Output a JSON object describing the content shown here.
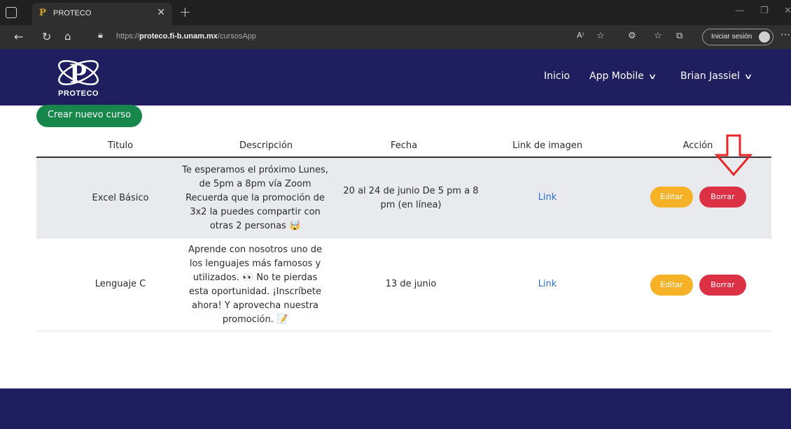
{
  "browser": {
    "tab_title": "PROTECO",
    "tab_favicon": "P",
    "url_prefix": "https://",
    "url_domain": "proteco.fi-b.unam.mx",
    "url_path": "/cursosApp",
    "signin_label": "Iniciar sesión"
  },
  "site": {
    "logo_text": "PROTECO",
    "nav": {
      "inicio": "Inicio",
      "app_mobile": "App Mobile",
      "user": "Brian Jassiel"
    }
  },
  "content": {
    "create_button": "Crear nuevo curso",
    "columns": [
      "Titulo",
      "Descripción",
      "Fecha",
      "Link de imagen",
      "Acción"
    ],
    "rows": [
      {
        "titulo": "Excel Básico",
        "descripcion": [
          "Te esperamos el próximo Lunes,",
          "de 5pm a 8pm vía Zoom",
          "Recuerda que la promoción de",
          "3x2 la puedes compartir con",
          "otras 2 personas 🤯"
        ],
        "fecha": [
          "20 al 24 de junio De 5 pm a 8",
          "pm (en línea)"
        ],
        "link": "Link",
        "edit": "Editar",
        "delete": "Borrar"
      },
      {
        "titulo": "Lenguaje C",
        "descripcion": [
          "Aprende con nosotros uno de",
          "los lenguajes más famosos y",
          "utilizados. 👀 No te pierdas",
          "esta oportunidad. ¡Inscríbete",
          "ahora! Y aprovecha nuestra",
          "promoción. 📝"
        ],
        "fecha": [
          "13 de junio"
        ],
        "link": "Link",
        "edit": "Editar",
        "delete": "Borrar"
      }
    ]
  },
  "colors": {
    "navbar": "#1f1f5f",
    "create": "#18874b",
    "edit": "#f5b227",
    "delete": "#dc3144",
    "link": "#2a6fdb",
    "annotation_arrow": "#e8262a"
  }
}
